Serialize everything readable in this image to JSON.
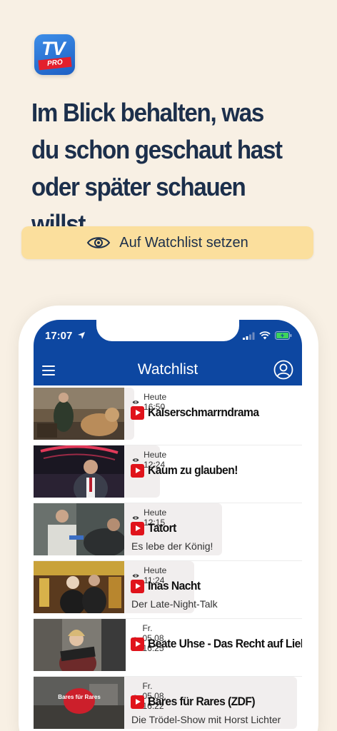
{
  "app_logo": {
    "line1": "TV",
    "line2": "PRO"
  },
  "headline": "Im Blick behalten, was du schon geschaut hast oder später schauen willst",
  "cta": {
    "label": "Auf Watchlist setzen",
    "icon": "eye-icon"
  },
  "phone": {
    "status": {
      "time": "17:07"
    },
    "nav": {
      "title": "Watchlist"
    },
    "items": [
      {
        "time": "Heute 16:50",
        "title": "Kaiserschmarrndrama",
        "subtitle": ""
      },
      {
        "time": "Heute 12:24",
        "title": "Kaum zu glauben!",
        "subtitle": ""
      },
      {
        "time": "Heute 12:15",
        "title": "Tatort",
        "subtitle": "Es lebe der König!"
      },
      {
        "time": "Heute 11:24",
        "title": "Inas Nacht",
        "subtitle": "Der Late-Night-Talk"
      },
      {
        "time": "Fr. 05.08. 16:25",
        "title": "Beate Uhse - Das Recht auf Liebe",
        "subtitle": ""
      },
      {
        "time": "Fr. 05.08. 16:22",
        "title": "Bares für Rares (ZDF)",
        "subtitle": "Die Trödel-Show mit Horst Lichter",
        "thumb_text": "Bares für Rares"
      }
    ]
  },
  "colors": {
    "background": "#f8f0e4",
    "cta": "#fbdf9d",
    "header": "#0d47a1",
    "headline": "#1c2f4b",
    "play": "#e0131b"
  }
}
